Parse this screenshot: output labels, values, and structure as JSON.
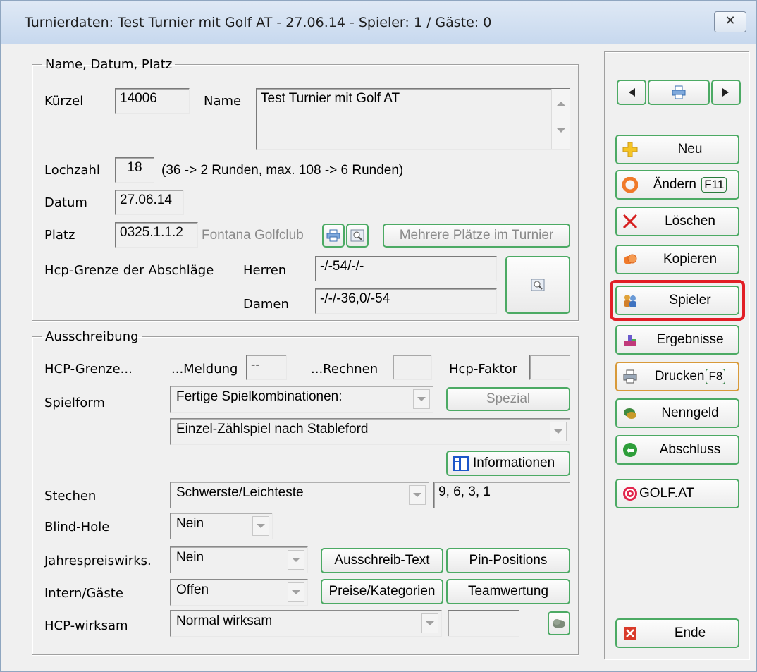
{
  "window": {
    "title": "Turnierdaten: Test Turnier mit Golf AT - 27.06.14 - Spieler: 1 / Gäste: 0",
    "close_label": "✕"
  },
  "name_group": {
    "legend": "Name, Datum, Platz",
    "kuerzel_label": "Kürzel",
    "kuerzel_value": "14006",
    "name_label": "Name",
    "name_value": "Test Turnier mit Golf AT",
    "lochzahl_label": "Lochzahl",
    "lochzahl_value": "18",
    "lochzahl_hint": "(36 -> 2 Runden, max. 108 -> 6 Runden)",
    "datum_label": "Datum",
    "datum_value": "27.06.14",
    "platz_label": "Platz",
    "platz_value": "0325.1.1.2",
    "platz_name": "Fontana Golfclub",
    "mehrere_plaetze_button": "Mehrere Plätze im Turnier",
    "hcp_grenze_label": "Hcp-Grenze der Abschläge",
    "herren_label": "Herren",
    "herren_value": "-/-54/-/-",
    "damen_label": "Damen",
    "damen_value": "-/-/-36,0/-54"
  },
  "ausschreibung_group": {
    "legend": "Ausschreibung",
    "hcp_grenze_label": "HCP-Grenze...",
    "meldung_label": "...Meldung",
    "meldung_value": "--",
    "rechnen_label": "...Rechnen",
    "rechnen_value": "",
    "hcp_faktor_label": "Hcp-Faktor",
    "hcp_faktor_value": "",
    "spielform_label": "Spielform",
    "spielform_value": "Fertige Spielkombinationen:",
    "spezial_button": "Spezial",
    "spielform_detail": "Einzel-Zählspiel nach Stableford",
    "informationen_button": "Informationen",
    "stechen_label": "Stechen",
    "stechen_value": "Schwerste/Leichteste",
    "stechen_holes": "9, 6, 3, 1",
    "blind_hole_label": "Blind-Hole",
    "blind_hole_value": "Nein",
    "jahrespreis_label": "Jahrespreiswirks.",
    "jahrespreis_value": "Nein",
    "ausschreib_text_button": "Ausschreib-Text",
    "pin_positions_button": "Pin-Positions",
    "intern_gaeste_label": "Intern/Gäste",
    "intern_gaeste_value": "Offen",
    "preise_kategorien_button": "Preise/Kategorien",
    "teamwertung_button": "Teamwertung",
    "hcp_wirksam_label": "HCP-wirksam",
    "hcp_wirksam_value": "Normal wirksam",
    "hcp_wirksam_extra": ""
  },
  "sidebar": {
    "neu": "Neu",
    "aendern": "Ändern",
    "aendern_key": "F11",
    "loeschen": "Löschen",
    "kopieren": "Kopieren",
    "spieler": "Spieler",
    "ergebnisse": "Ergebnisse",
    "drucken": "Drucken",
    "drucken_key": "F8",
    "nenngeld": "Nenngeld",
    "abschluss": "Abschluss",
    "golf_at": "GOLF.AT",
    "ende": "Ende"
  },
  "colors": {
    "button_border": "#4caa64",
    "highlight": "#e21e26"
  }
}
